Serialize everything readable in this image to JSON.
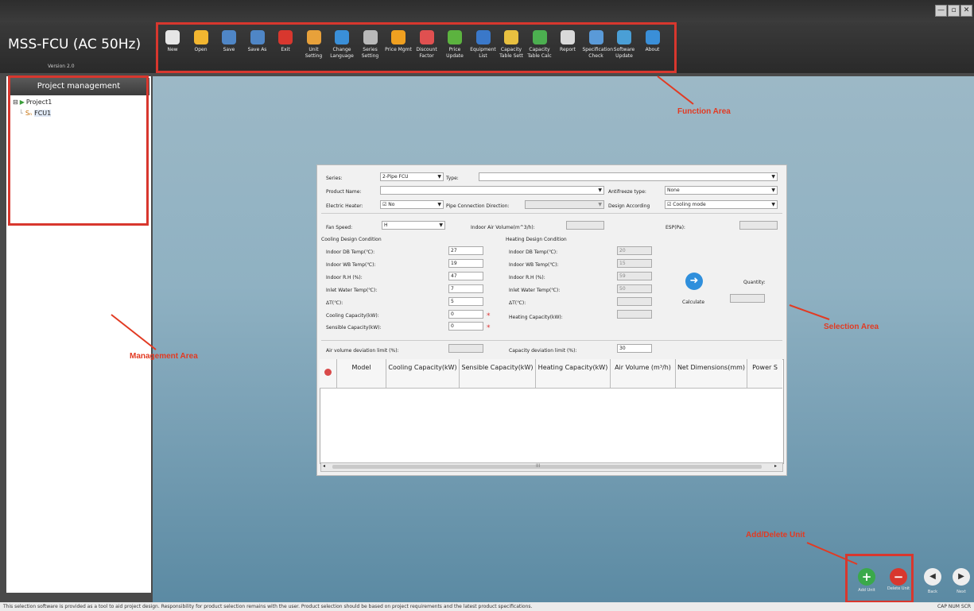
{
  "window": {
    "min": "—",
    "max": "▫",
    "close": "✕"
  },
  "app": {
    "name": "MSS-FCU (AC 50Hz)",
    "version": "Version 2.0"
  },
  "toolbar": [
    {
      "label": "New",
      "icon": "new-file-icon",
      "color": "#e6e6e6"
    },
    {
      "label": "Open",
      "icon": "open-folder-icon",
      "color": "#f2b630"
    },
    {
      "label": "Save",
      "icon": "save-disk-icon",
      "color": "#4f86c6"
    },
    {
      "label": "Save As",
      "icon": "save-as-icon",
      "color": "#4f86c6"
    },
    {
      "label": "Exit",
      "icon": "exit-icon",
      "color": "#d8372e"
    },
    {
      "label": "Unit Setting",
      "icon": "pencil-icon",
      "color": "#e8a13a"
    },
    {
      "label": "Change Language",
      "icon": "globe-icon",
      "color": "#3a8fd8"
    },
    {
      "label": "Series Setting",
      "icon": "tools-icon",
      "color": "#b9b9b9"
    },
    {
      "label": "Price Mgmt",
      "icon": "price-icon",
      "color": "#f0a020"
    },
    {
      "label": "Discount Factor",
      "icon": "discount-icon",
      "color": "#e05050"
    },
    {
      "label": "Price Update",
      "icon": "refresh-icon",
      "color": "#5cb33f"
    },
    {
      "label": "Equipment List",
      "icon": "list-icon",
      "color": "#3a78c9"
    },
    {
      "label": "Capacity Table Sett",
      "icon": "gear-icon",
      "color": "#e8c040"
    },
    {
      "label": "Capacity Table Calc",
      "icon": "spreadsheet-icon",
      "color": "#4caf50"
    },
    {
      "label": "Report",
      "icon": "printer-icon",
      "color": "#d9d9d9"
    },
    {
      "label": "Specification Check",
      "icon": "magnifier-icon",
      "color": "#5a9ad8"
    },
    {
      "label": "Software Update",
      "icon": "update-globe-icon",
      "color": "#4a9fd6"
    },
    {
      "label": "About",
      "icon": "help-icon",
      "color": "#3a8fd8"
    }
  ],
  "sidebar": {
    "title": "Project management",
    "tree_expander": "⊟",
    "project": "Project1",
    "unit_prefix": "Sₙ",
    "unit": "FCU1"
  },
  "annotations": {
    "function": "Function Area",
    "management": "Management Area",
    "selection": "Selection Area",
    "add_delete": "Add/Delete Unit"
  },
  "form": {
    "series_label": "Series:",
    "series_value": "2-Pipe FCU",
    "type_label": "Type:",
    "type_value": "",
    "product_label": "Product Name:",
    "product_value": "",
    "antifreeze_label": "Antifreeze type:",
    "antifreeze_value": "None",
    "heater_label": "Electric Heater:",
    "heater_value": "☑ No",
    "pipe_label": "Pipe Connection Direction:",
    "pipe_value": "",
    "design_label": "Design According",
    "design_value": "☑ Cooling mode",
    "fan_label": "Fan Speed:",
    "fan_value": "H",
    "airvol_label": "Indoor Air Volume(m^3/h):",
    "airvol_value": "",
    "esp_label": "ESP(Pa):",
    "esp_value": "",
    "cooling_title": "Cooling Design Condition",
    "heating_title": "Heating Design Condition",
    "c_db_label": "Indoor DB Temp(℃):",
    "c_db": "27",
    "c_wb_label": "Indoor WB Temp(℃):",
    "c_wb": "19",
    "c_rh_label": "Indoor R.H (%):",
    "c_rh": "47",
    "c_iw_label": "Inlet Water Temp(℃):",
    "c_iw": "7",
    "c_dt_label": "ΔT(℃):",
    "c_dt": "5",
    "c_cap_label": "Cooling Capacity(kW):",
    "c_cap": "0",
    "c_sens_label": "Sensible Capacity(kW):",
    "c_sens": "0",
    "star": "*",
    "h_db_label": "Indoor DB Temp(℃):",
    "h_db": "20",
    "h_wb_label": "Indoor WB Temp(℃):",
    "h_wb": "15",
    "h_rh_label": "Indoor R.H (%):",
    "h_rh": "59",
    "h_iw_label": "Inlet Water Temp(℃):",
    "h_iw": "50",
    "h_dt_label": "ΔT(℃):",
    "h_dt": "",
    "h_cap_label": "Heating Capacity(kW):",
    "h_cap": "",
    "calculate": "Calculate",
    "quantity_label": "Quantity:",
    "quantity": "",
    "airdev_label": "Air volume deviation limit (%):",
    "airdev": "",
    "capdev_label": "Capacity deviation limit (%):",
    "capdev": "30"
  },
  "table": {
    "columns": [
      "Model",
      "Cooling Capacity(kW)",
      "Sensible Capacity(kW)",
      "Heating Capacity(kW)",
      "Air Volume (m³/h)",
      "Net Dimensions(mm)",
      "Power S"
    ],
    "scroll_left": "◂",
    "scroll_mid": "III",
    "scroll_right": "▸"
  },
  "bottom": {
    "add": "Add Unit",
    "delete": "Delete Unit",
    "back": "Back",
    "next": "Next",
    "add_glyph": "+",
    "delete_glyph": "−",
    "back_glyph": "◀",
    "next_glyph": "▶"
  },
  "status": {
    "text": "This selection software is provided as a tool to aid project design. Responsibility for product selection remains with the user. Product selection should be based on project requirements and the latest product specifications.",
    "keys": "CAP  NUM  SCR"
  }
}
